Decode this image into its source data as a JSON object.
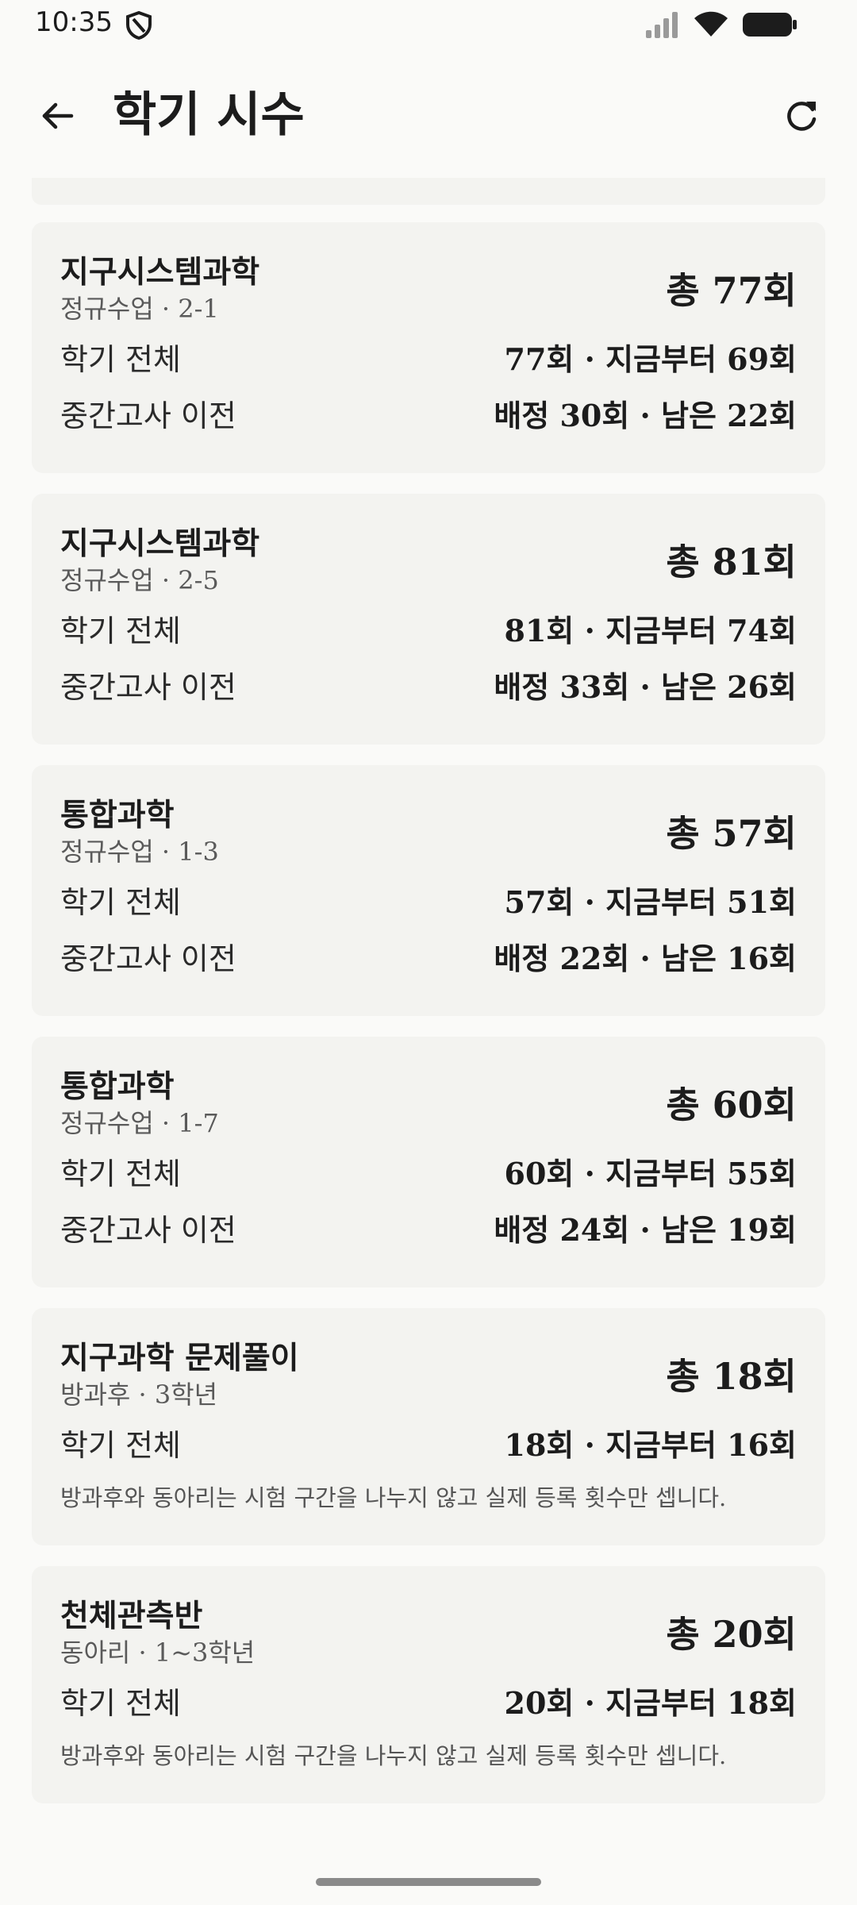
{
  "status_bar": {
    "time": "10:35",
    "icons": [
      "shield-icon",
      "cellular-signal-icon",
      "wifi-icon",
      "battery-icon"
    ]
  },
  "app_bar": {
    "title": "학기 시수",
    "back_icon": "arrow-left-icon",
    "refresh_icon": "refresh-icon"
  },
  "colors": {
    "background": "#fafaf8",
    "card": "#f3f3f0",
    "text": "#1c1c1c",
    "muted": "#5a5a5a"
  },
  "cards": [
    {
      "title": "지구시스템과학",
      "subtitle": "정규수업 · 2-1",
      "total": "총 77회",
      "rows": [
        {
          "label": "학기 전체",
          "value": "77회 · 지금부터 69회"
        },
        {
          "label": "중간고사 이전",
          "value": "배정 30회 · 남은 22회"
        }
      ]
    },
    {
      "title": "지구시스템과학",
      "subtitle": "정규수업 · 2-5",
      "total": "총 81회",
      "rows": [
        {
          "label": "학기 전체",
          "value": "81회 · 지금부터 74회"
        },
        {
          "label": "중간고사 이전",
          "value": "배정 33회 · 남은 26회"
        }
      ]
    },
    {
      "title": "통합과학",
      "subtitle": "정규수업 · 1-3",
      "total": "총 57회",
      "rows": [
        {
          "label": "학기 전체",
          "value": "57회 · 지금부터 51회"
        },
        {
          "label": "중간고사 이전",
          "value": "배정 22회 · 남은 16회"
        }
      ]
    },
    {
      "title": "통합과학",
      "subtitle": "정규수업 · 1-7",
      "total": "총 60회",
      "rows": [
        {
          "label": "학기 전체",
          "value": "60회 · 지금부터 55회"
        },
        {
          "label": "중간고사 이전",
          "value": "배정 24회 · 남은 19회"
        }
      ]
    },
    {
      "title": "지구과학 문제풀이",
      "subtitle": "방과후 · 3학년",
      "total": "총 18회",
      "rows": [
        {
          "label": "학기 전체",
          "value": "18회 · 지금부터 16회"
        }
      ],
      "note": "방과후와 동아리는 시험 구간을 나누지 않고 실제 등록 횟수만 셉니다."
    },
    {
      "title": "천체관측반",
      "subtitle": "동아리 · 1~3학년",
      "total": "총 20회",
      "rows": [
        {
          "label": "학기 전체",
          "value": "20회 · 지금부터 18회"
        }
      ],
      "note": "방과후와 동아리는 시험 구간을 나누지 않고 실제 등록 횟수만 셉니다."
    }
  ]
}
